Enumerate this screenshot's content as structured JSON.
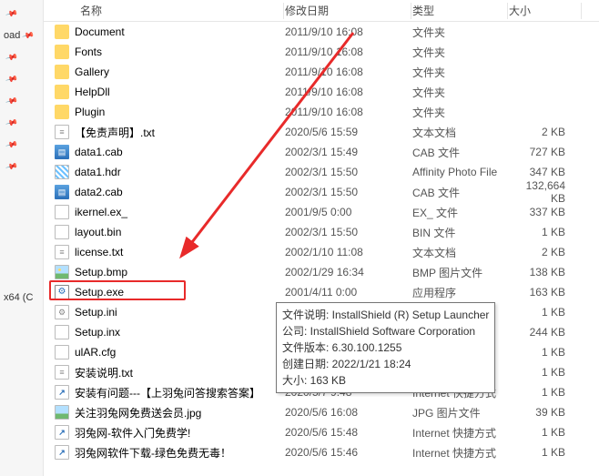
{
  "sidebar": {
    "items": [
      {
        "label": ""
      },
      {
        "label": "oad"
      },
      {
        "label": ""
      },
      {
        "label": ""
      },
      {
        "label": ""
      },
      {
        "label": ""
      },
      {
        "label": ""
      },
      {
        "label": ""
      },
      {
        "label": ""
      },
      {
        "label": ""
      },
      {
        "label": ""
      },
      {
        "label": ""
      },
      {
        "label": ""
      },
      {
        "label": "x64 (C"
      },
      {
        "label": ""
      }
    ]
  },
  "columns": {
    "name": "名称",
    "date": "修改日期",
    "type": "类型",
    "size": "大小"
  },
  "rows": [
    {
      "icon": "folder",
      "name": "Document",
      "date": "2011/9/10 16:08",
      "type": "文件夹",
      "size": ""
    },
    {
      "icon": "folder",
      "name": "Fonts",
      "date": "2011/9/10 16:08",
      "type": "文件夹",
      "size": ""
    },
    {
      "icon": "folder",
      "name": "Gallery",
      "date": "2011/9/10 16:08",
      "type": "文件夹",
      "size": ""
    },
    {
      "icon": "folder",
      "name": "HelpDll",
      "date": "2011/9/10 16:08",
      "type": "文件夹",
      "size": ""
    },
    {
      "icon": "folder",
      "name": "Plugin",
      "date": "2011/9/10 16:08",
      "type": "文件夹",
      "size": ""
    },
    {
      "icon": "txt",
      "name": "【免责声明】.txt",
      "date": "2020/5/6 15:59",
      "type": "文本文档",
      "size": "2 KB"
    },
    {
      "icon": "cab",
      "name": "data1.cab",
      "date": "2002/3/1 15:49",
      "type": "CAB 文件",
      "size": "727 KB"
    },
    {
      "icon": "hdr",
      "name": "data1.hdr",
      "date": "2002/3/1 15:50",
      "type": "Affinity Photo File",
      "size": "347 KB"
    },
    {
      "icon": "cab",
      "name": "data2.cab",
      "date": "2002/3/1 15:50",
      "type": "CAB 文件",
      "size": "132,664 KB"
    },
    {
      "icon": "generic",
      "name": "ikernel.ex_",
      "date": "2001/9/5 0:00",
      "type": "EX_ 文件",
      "size": "337 KB"
    },
    {
      "icon": "generic",
      "name": "layout.bin",
      "date": "2002/3/1 15:50",
      "type": "BIN 文件",
      "size": "1 KB"
    },
    {
      "icon": "txt",
      "name": "license.txt",
      "date": "2002/1/10 11:08",
      "type": "文本文档",
      "size": "2 KB"
    },
    {
      "icon": "bmp",
      "name": "Setup.bmp",
      "date": "2002/1/29 16:34",
      "type": "BMP 图片文件",
      "size": "138 KB"
    },
    {
      "icon": "exe",
      "name": "Setup.exe",
      "date": "2001/4/11 0:00",
      "type": "应用程序",
      "size": "163 KB"
    },
    {
      "icon": "ini",
      "name": "Setup.ini",
      "date": "",
      "type": "",
      "size": "1 KB"
    },
    {
      "icon": "generic",
      "name": "Setup.inx",
      "date": "",
      "type": "",
      "size": "244 KB"
    },
    {
      "icon": "generic",
      "name": "ulAR.cfg",
      "date": "",
      "type": "",
      "size": "1 KB"
    },
    {
      "icon": "txt",
      "name": "安装说明.txt",
      "date": "",
      "type": "",
      "size": "1 KB"
    },
    {
      "icon": "url",
      "name": "安装有问题---【上羽兔问答搜索答案】",
      "date": "2020/5/7 9:48",
      "type": "Internet 快捷方式",
      "size": "1 KB"
    },
    {
      "icon": "jpg",
      "name": "关注羽兔网免费送会员.jpg",
      "date": "2020/5/6 16:08",
      "type": "JPG 图片文件",
      "size": "39 KB"
    },
    {
      "icon": "url",
      "name": "羽兔网-软件入门免费学!",
      "date": "2020/5/6 15:48",
      "type": "Internet 快捷方式",
      "size": "1 KB"
    },
    {
      "icon": "url",
      "name": "羽兔网软件下载-绿色免费无毒！",
      "date": "2020/5/6 15:46",
      "type": "Internet 快捷方式",
      "size": "1 KB"
    }
  ],
  "tooltip": {
    "line1": "文件说明: InstallShield (R) Setup Launcher",
    "line2": "公司: InstallShield Software Corporation",
    "line3": "文件版本: 6.30.100.1255",
    "line4": "创建日期: 2022/1/21 18:24",
    "line5": "大小: 163 KB"
  }
}
